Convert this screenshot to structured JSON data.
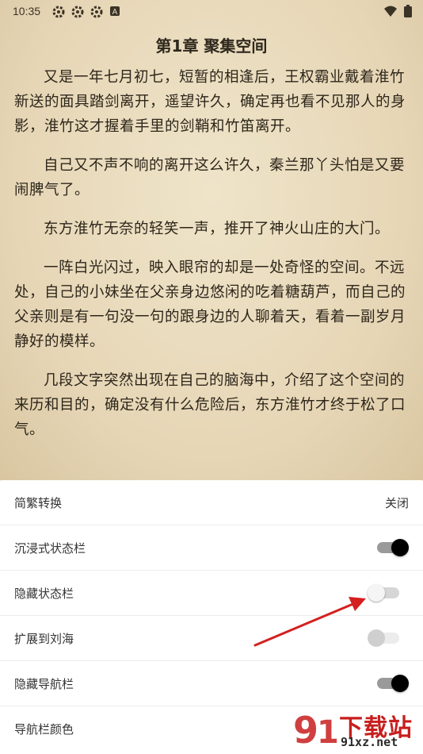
{
  "status_bar": {
    "time": "10:35",
    "notification_icons": [
      "settings-gear-icon",
      "settings-gear-icon",
      "settings-gear-icon",
      "a-badge-icon"
    ],
    "right_icons": [
      "wifi-icon",
      "battery-icon"
    ]
  },
  "reader": {
    "chapter_title": "第1章 聚集空间",
    "paragraphs": [
      "又是一年七月初七，短暂的相逢后，王权霸业戴着淮竹新送的面具踏剑离开，遥望许久，确定再也看不见那人的身影，淮竹这才握着手里的剑鞘和竹笛离开。",
      "自己又不声不响的离开这么许久，秦兰那丫头怕是又要闹脾气了。",
      "东方淮竹无奈的轻笑一声，推开了神火山庄的大门。",
      "一阵白光闪过，映入眼帘的却是一处奇怪的空间。不远处，自己的小妹坐在父亲身边悠闲的吃着糖葫芦，而自己的父亲则是有一句没一句的跟身边的人聊着天，看着一副岁月静好的模样。",
      "几段文字突然出现在自己的脑海中，介绍了这个空间的来历和目的，确定没有什么危险后，东方淮竹才终于松了口气。"
    ],
    "background_color": "#e9dcbf"
  },
  "settings": {
    "rows": [
      {
        "label": "简繁转换",
        "value": "关闭"
      },
      {
        "label": "沉浸式状态栏",
        "toggle": "on"
      },
      {
        "label": "隐藏状态栏",
        "toggle": "off"
      },
      {
        "label": "扩展到刘海",
        "toggle": "disabled"
      },
      {
        "label": "隐藏导航栏",
        "toggle": "on"
      },
      {
        "label": "导航栏颜色"
      }
    ]
  },
  "annotation": {
    "arrow_color": "#d42020"
  },
  "watermark": {
    "brand": "下载站",
    "domain": "91xz.net",
    "color": "#c81e1e"
  }
}
